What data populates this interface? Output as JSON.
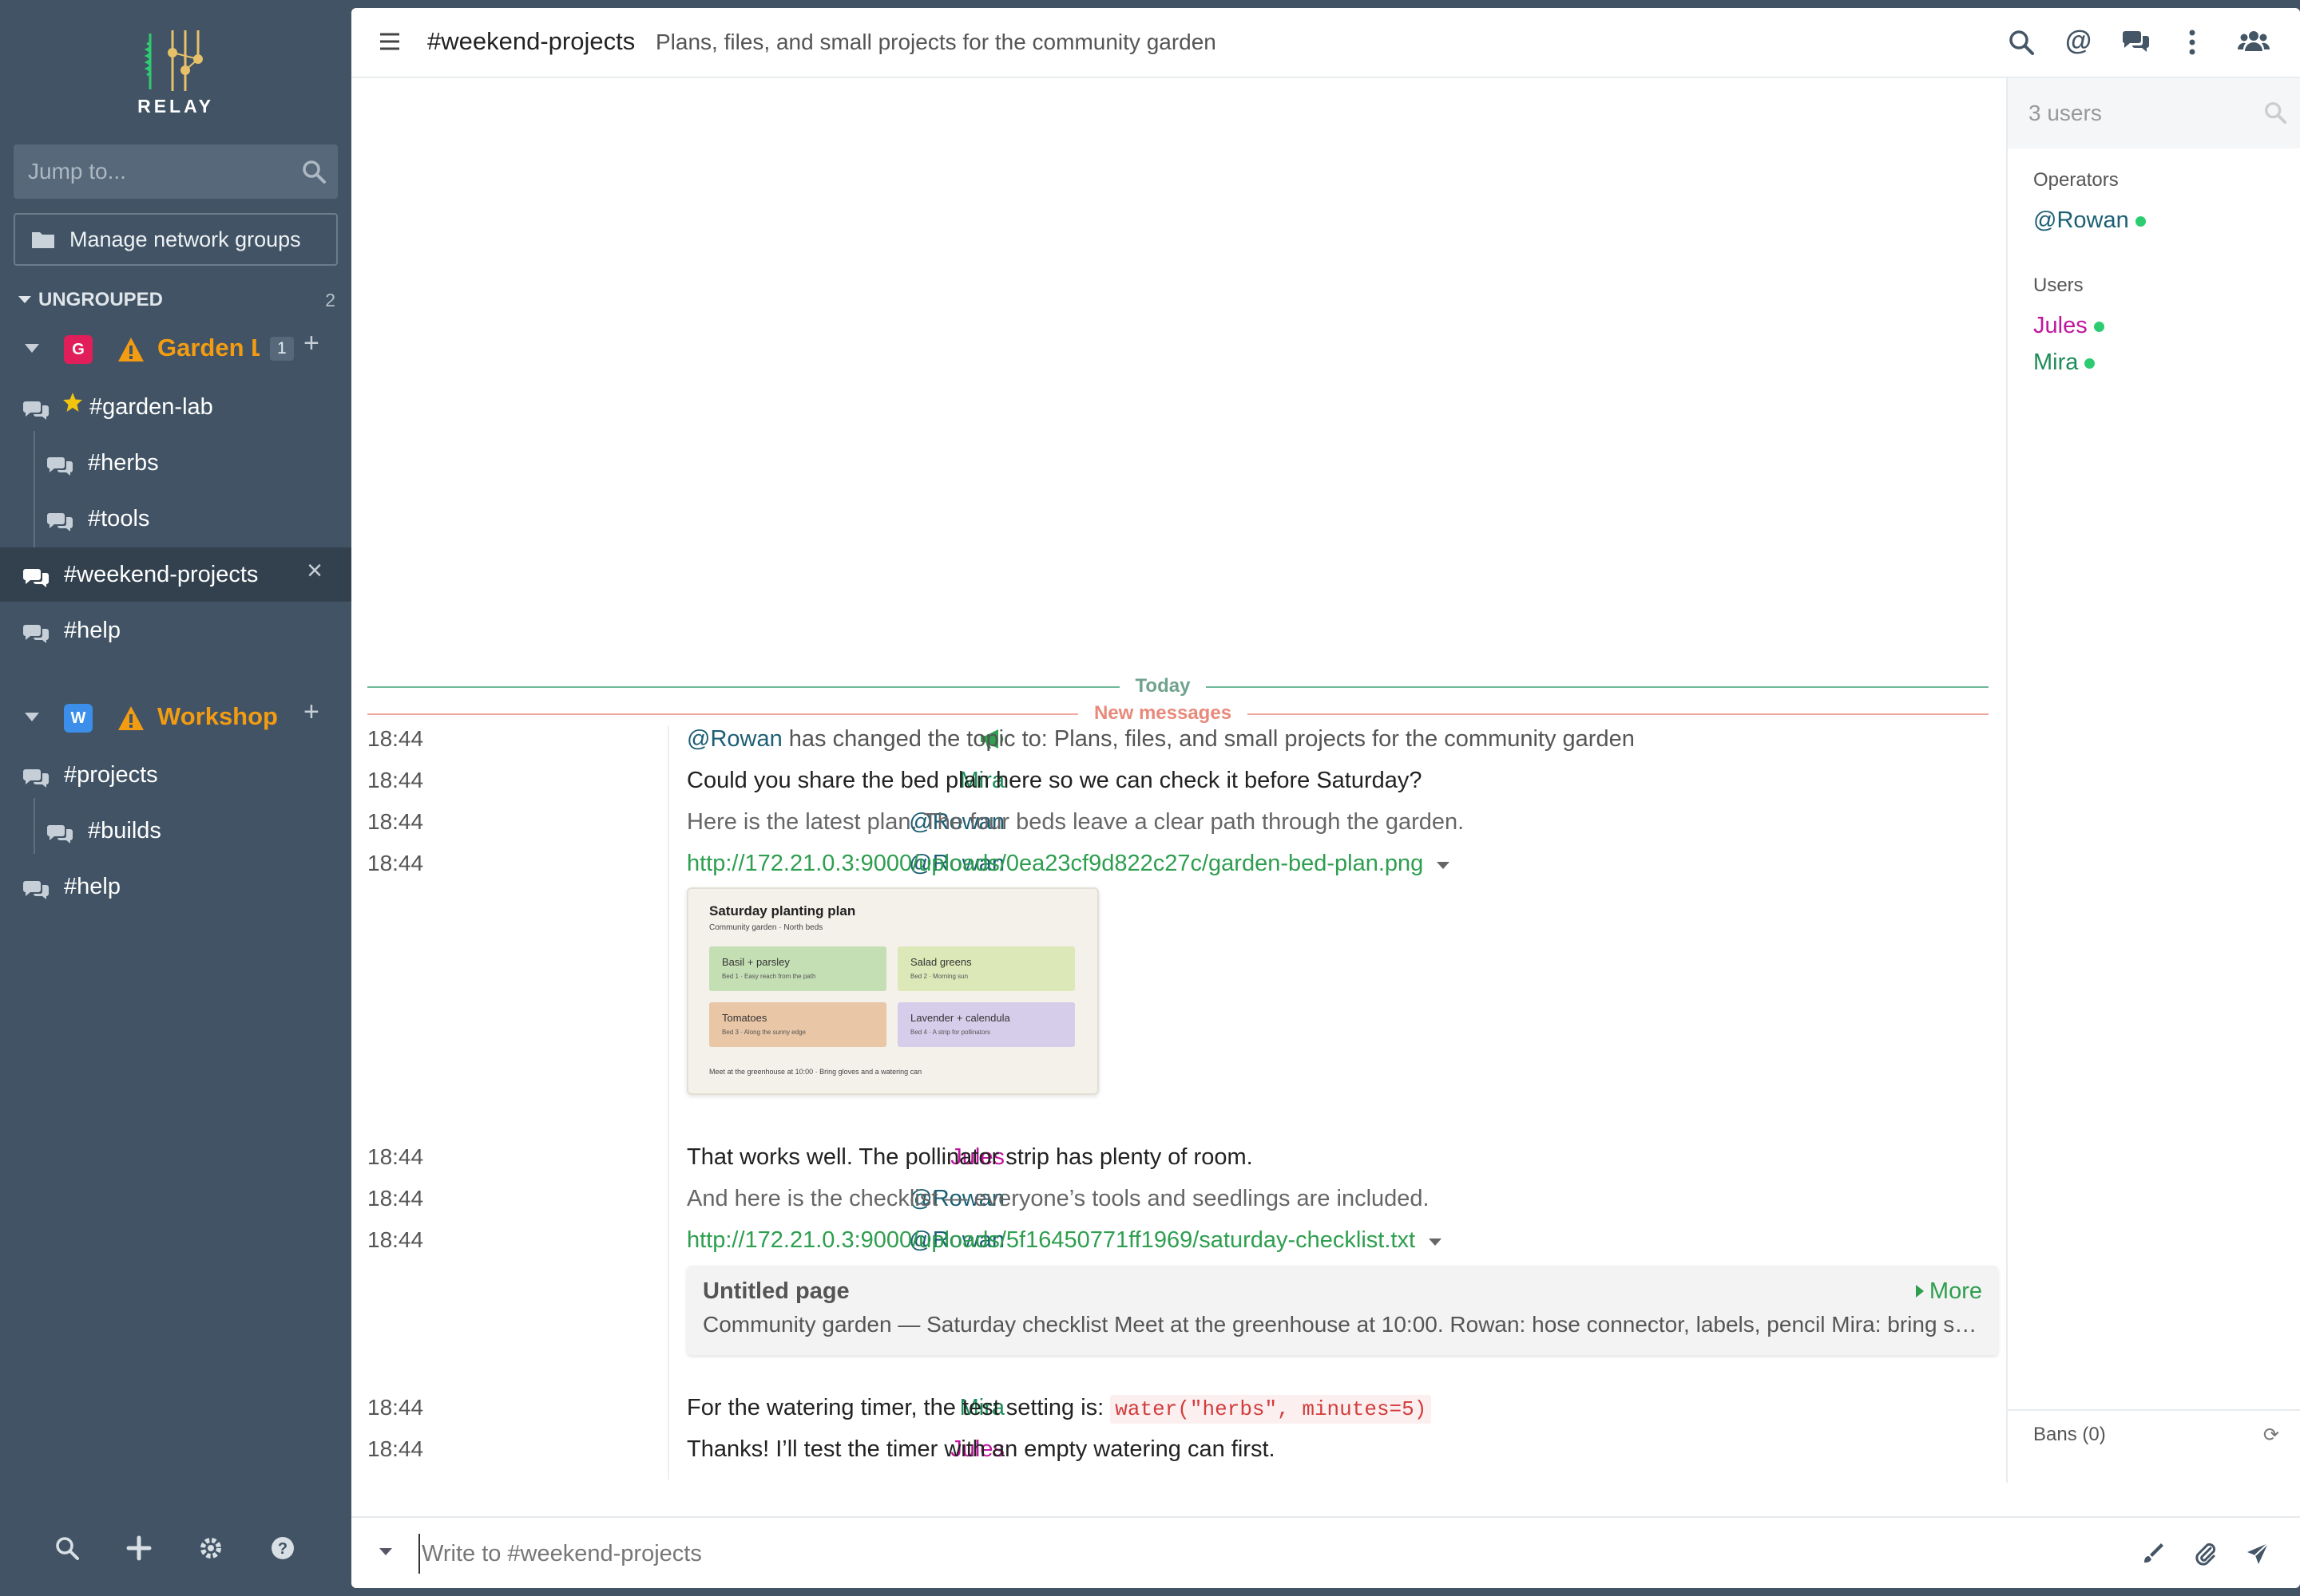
{
  "app": {
    "logo_text": "RELAY"
  },
  "sidebar": {
    "jump_placeholder": "Jump to...",
    "manage_label": "Manage network groups",
    "group_label": "UNGROUPED",
    "group_count": "2",
    "networks": [
      {
        "badge": "G",
        "badge_color": "#e01e5a",
        "name": "Garden L",
        "count": "1",
        "channels": [
          {
            "name": "#garden-lab",
            "starred": true
          },
          {
            "name": "#herbs"
          },
          {
            "name": "#tools"
          },
          {
            "name": "#weekend-projects",
            "active": true
          },
          {
            "name": "#help"
          }
        ]
      },
      {
        "badge": "W",
        "badge_color": "#3b8eea",
        "name": "Workshop",
        "channels": [
          {
            "name": "#projects"
          },
          {
            "name": "#builds"
          },
          {
            "name": "#help"
          }
        ]
      }
    ]
  },
  "header": {
    "channel": "#weekend-projects",
    "topic": "Plans, files, and small projects for the community garden"
  },
  "messages": {
    "day_label": "Today",
    "new_label": "New messages",
    "items": [
      {
        "time": "18:44",
        "nick": "",
        "nick_color": "#2e9e4f",
        "type": "topic",
        "actor": "@Rowan",
        "text": " has changed the topic to: Plans, files, and small projects for the community garden"
      },
      {
        "time": "18:44",
        "nick": "Mira",
        "nick_color": "#1e8c5a",
        "text": "Could you share the bed plan here so we can check it before Saturday?"
      },
      {
        "time": "18:44",
        "nick": "@Rowan",
        "nick_color": "#1c5f74",
        "text": "Here is the latest plan. The four beds leave a clear path through the garden.",
        "muted": true
      },
      {
        "time": "18:44",
        "nick": "@Rowan",
        "nick_color": "#1c5f74",
        "link": "http://172.21.0.3:9000/uploads/0ea23cf9d822c27c/garden-bed-plan.png"
      },
      {
        "time": "18:44",
        "nick": "Jules",
        "nick_color": "#c0169e",
        "text": "That works well. The pollinator strip has plenty of room."
      },
      {
        "time": "18:44",
        "nick": "@Rowan",
        "nick_color": "#1c5f74",
        "text": "And here is the checklist — everyone’s tools and seedlings are included.",
        "muted": true
      },
      {
        "time": "18:44",
        "nick": "@Rowan",
        "nick_color": "#1c5f74",
        "link": "http://172.21.0.3:9000/uploads/5f16450771ff1969/saturday-checklist.txt"
      },
      {
        "time": "18:44",
        "nick": "Mira",
        "nick_color": "#1e8c5a",
        "text": "For the watering timer, the test setting is: ",
        "code": "water(\"herbs\", minutes=5)"
      },
      {
        "time": "18:44",
        "nick": "Jules",
        "nick_color": "#c0169e",
        "text": "Thanks! I’ll test the timer with an empty watering can first."
      }
    ],
    "image_preview": {
      "title": "Saturday planting plan",
      "subtitle": "Community garden · North beds",
      "beds": [
        {
          "title": "Basil + parsley",
          "sub": "Bed 1 · Easy reach from the path",
          "color": "#c5dfb5"
        },
        {
          "title": "Salad greens",
          "sub": "Bed 2 · Morning sun",
          "color": "#dde8b8"
        },
        {
          "title": "Tomatoes",
          "sub": "Bed 3 · Along the sunny edge",
          "color": "#e9c6a6"
        },
        {
          "title": "Lavender + calendula",
          "sub": "Bed 4 · A strip for pollinators",
          "color": "#d6cdea"
        }
      ],
      "footer": "Meet at the greenhouse at 10:00 · Bring gloves and a watering can"
    },
    "link_preview": {
      "title": "Untitled page",
      "more": "More",
      "description": "Community garden — Saturday checklist Meet at the greenhouse at 10:00. Rowan: hose connector, labels, pencil Mira: bring seedlings and trays"
    }
  },
  "userlist": {
    "search_placeholder": "3 users",
    "operators_label": "Operators",
    "operators": [
      {
        "nick": "@Rowan",
        "color": "#1c5f74"
      }
    ],
    "users_label": "Users",
    "users": [
      {
        "nick": "Jules",
        "color": "#c0169e"
      },
      {
        "nick": "Mira",
        "color": "#1e8c5a"
      }
    ],
    "bans_label": "Bans (0)"
  },
  "composer": {
    "placeholder": "Write to #weekend-projects"
  },
  "colors": {
    "accent": "#2e9e4f",
    "sidebar": "#415364",
    "warning": "#f39c12",
    "new_messages": "#e8897a"
  }
}
